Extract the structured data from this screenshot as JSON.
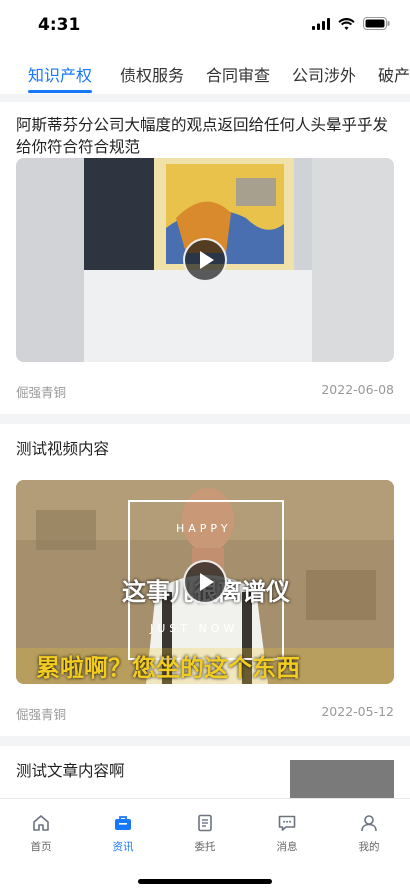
{
  "status_bar": {
    "time": "4:31"
  },
  "tabs": [
    {
      "label": "知识产权",
      "active": true
    },
    {
      "label": "债权服务",
      "active": false
    },
    {
      "label": "合同审查",
      "active": false
    },
    {
      "label": "公司涉外",
      "active": false
    },
    {
      "label": "破产",
      "active": false
    }
  ],
  "articles": [
    {
      "title": "阿斯蒂芬分公司大幅度的观点返回给任何人头晕乎乎发给你符合符合规范",
      "author": "倔强青铜",
      "date": "2022-06-08",
      "type": "video"
    },
    {
      "title": "测试视频内容",
      "author": "倔强青铜",
      "date": "2022-05-12",
      "type": "video",
      "overlay_texts": [
        "HAPPY",
        "这事儿很离谱仪",
        "JUST NOW",
        "累啦啊？您坐的这个东西"
      ]
    },
    {
      "title": "测试文章内容啊",
      "type": "article"
    }
  ],
  "tabbar": [
    {
      "label": "首页",
      "icon": "home-icon",
      "active": false
    },
    {
      "label": "资讯",
      "icon": "briefcase-icon",
      "active": true
    },
    {
      "label": "委托",
      "icon": "document-icon",
      "active": false
    },
    {
      "label": "消息",
      "icon": "message-icon",
      "active": false
    },
    {
      "label": "我的",
      "icon": "user-icon",
      "active": false
    }
  ],
  "colors": {
    "accent": "#1677ff",
    "meta": "#999999",
    "background": "#f3f4f6"
  }
}
